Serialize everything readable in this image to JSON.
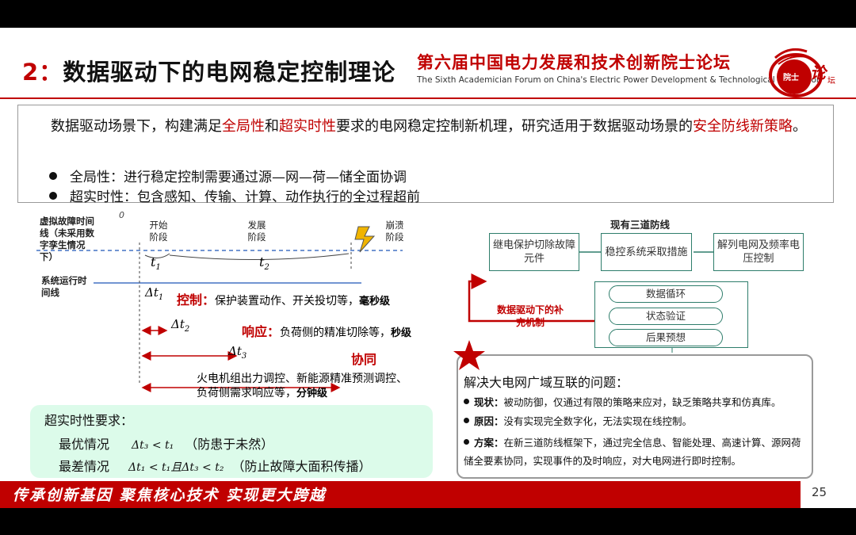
{
  "header": {
    "title_num": "2：",
    "title_text": "数据驱动下的电网稳定控制理论",
    "forum_cn": "第六届中国电力发展和技术创新院士论坛",
    "forum_en": "The Sixth Academician Forum on China's Electric Power Development & Technological Innovation",
    "logo_text": "院士论坛"
  },
  "intro": {
    "p1": "数据驱动场景下，构建满足",
    "hl1": "全局性",
    "p2": "和",
    "hl2": "超实时性",
    "p3": "要求的电网稳定控制新机理，研究适用于数据驱动场景的",
    "hl3": "安全防线新策略",
    "p4": "。",
    "bullets": [
      "全局性：进行稳定控制需要通过源—网—荷—储全面协调",
      "超实时性：包含感知、传输、计算、动作执行的全过程超前"
    ]
  },
  "timeline": {
    "virtual_label": "虚拟故障时间线（未采用数字孪生情况下）",
    "system_label": "系统运行时间线",
    "zero": "0",
    "stage1": "开始阶段",
    "stage2": "发展阶段",
    "stage3": "崩溃阶段",
    "t1": "t",
    "t1_sub": "1",
    "t2": "t",
    "t2_sub": "2",
    "dt1": "Δt",
    "dt1_sub": "1",
    "dt2": "Δt",
    "dt2_sub": "2",
    "dt3": "Δt",
    "dt3_sub": "3",
    "control_label": "控制：",
    "control_text": "保护装置动作、开关投切等，",
    "control_level": "毫秒级",
    "response_label": "响应：",
    "response_text": "负荷侧的精准切除等，",
    "response_level": "秒级",
    "coord_label": "协同",
    "coord_line1": "火电机组出力调控、新能源精准预测调控、",
    "coord_line2": "负荷侧需求响应等，",
    "coord_level": "分钟级"
  },
  "requirements": {
    "title": "超实时性要求：",
    "best_label": "最优情况",
    "best_formula": "Δt₃ < t₁",
    "best_note": "（防患于未然）",
    "worst_label": "最差情况",
    "worst_formula": "Δt₁ < t₁且Δt₃ < t₂",
    "worst_note": "（防止故障大面积传播）"
  },
  "defense": {
    "title": "现有三道防线",
    "boxes": [
      "继电保护切除故障元件",
      "稳控系统采取措施",
      "解列电网及频率电压控制"
    ],
    "data_driven_label": "数据驱动下的补充机制",
    "pills": [
      "数据循环",
      "状态验证",
      "后果预想"
    ]
  },
  "solution": {
    "title": "解决大电网广域互联的问题：",
    "items": [
      {
        "label": "现状：",
        "text": "被动防御，仅通过有限的策略来应对，缺乏策略共享和仿真库。"
      },
      {
        "label": "原因：",
        "text": "没有实现完全数字化，无法实现在线控制。"
      },
      {
        "label": "方案：",
        "text": "在新三道防线框架下，通过完全信息、智能处理、高速计算、源网荷储全要素协同，实现事件的及时响应，对大电网进行即时控制。"
      }
    ]
  },
  "footer": {
    "slogan": "传承创新基因  聚焦核心技术  实现更大跨越",
    "page": "25"
  },
  "colors": {
    "accent": "#c00000",
    "teal": "#2e7d6b",
    "mint": "#dcfbea",
    "blue": "#4472c4"
  }
}
